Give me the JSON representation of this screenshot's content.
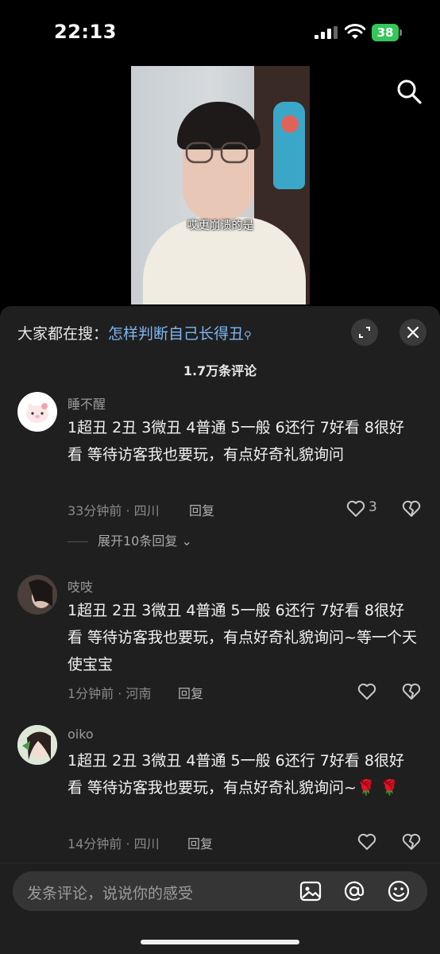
{
  "status_bar": {
    "time": "22:13",
    "battery": "38"
  },
  "video": {
    "caption": "哎更崩溃的是"
  },
  "sheet": {
    "search_prefix": "大家都在搜：",
    "search_query": "怎样判断自己长得丑",
    "comment_count": "1.7万条评论"
  },
  "comments": [
    {
      "username": "睡不醒",
      "text": "1超丑 2丑 3微丑 4普通 5一般 6还行 7好看 8很好看 等待访客我也要玩，有点好奇礼貌询问",
      "time_location": "33分钟前 · 四川",
      "reply_label": "回复",
      "likes": "3",
      "expand_replies": "展开10条回复"
    },
    {
      "username": "吱吱",
      "text": "1超丑 2丑 3微丑 4普通 5一般 6还行 7好看 8很好看 等待访客我也要玩，有点好奇礼貌询问~等一个天使宝宝",
      "time_location": "1分钟前 · 河南",
      "reply_label": "回复",
      "likes": ""
    },
    {
      "username": "oiko",
      "text": "1超丑 2丑 3微丑 4普通 5一般 6还行 7好看 8很好看 等待访客我也要玩，有点好奇礼貌询问~🌹 🌹",
      "time_location": "14分钟前 · 四川",
      "reply_label": "回复",
      "likes": ""
    }
  ],
  "input": {
    "placeholder": "发条评论，说说你的感受"
  },
  "icons": {
    "search": "search-icon",
    "expand": "expand-icon",
    "close": "close-icon",
    "like": "heart-icon",
    "dislike": "broken-heart-icon",
    "image": "image-icon",
    "mention": "at-icon",
    "emoji": "emoji-icon"
  }
}
